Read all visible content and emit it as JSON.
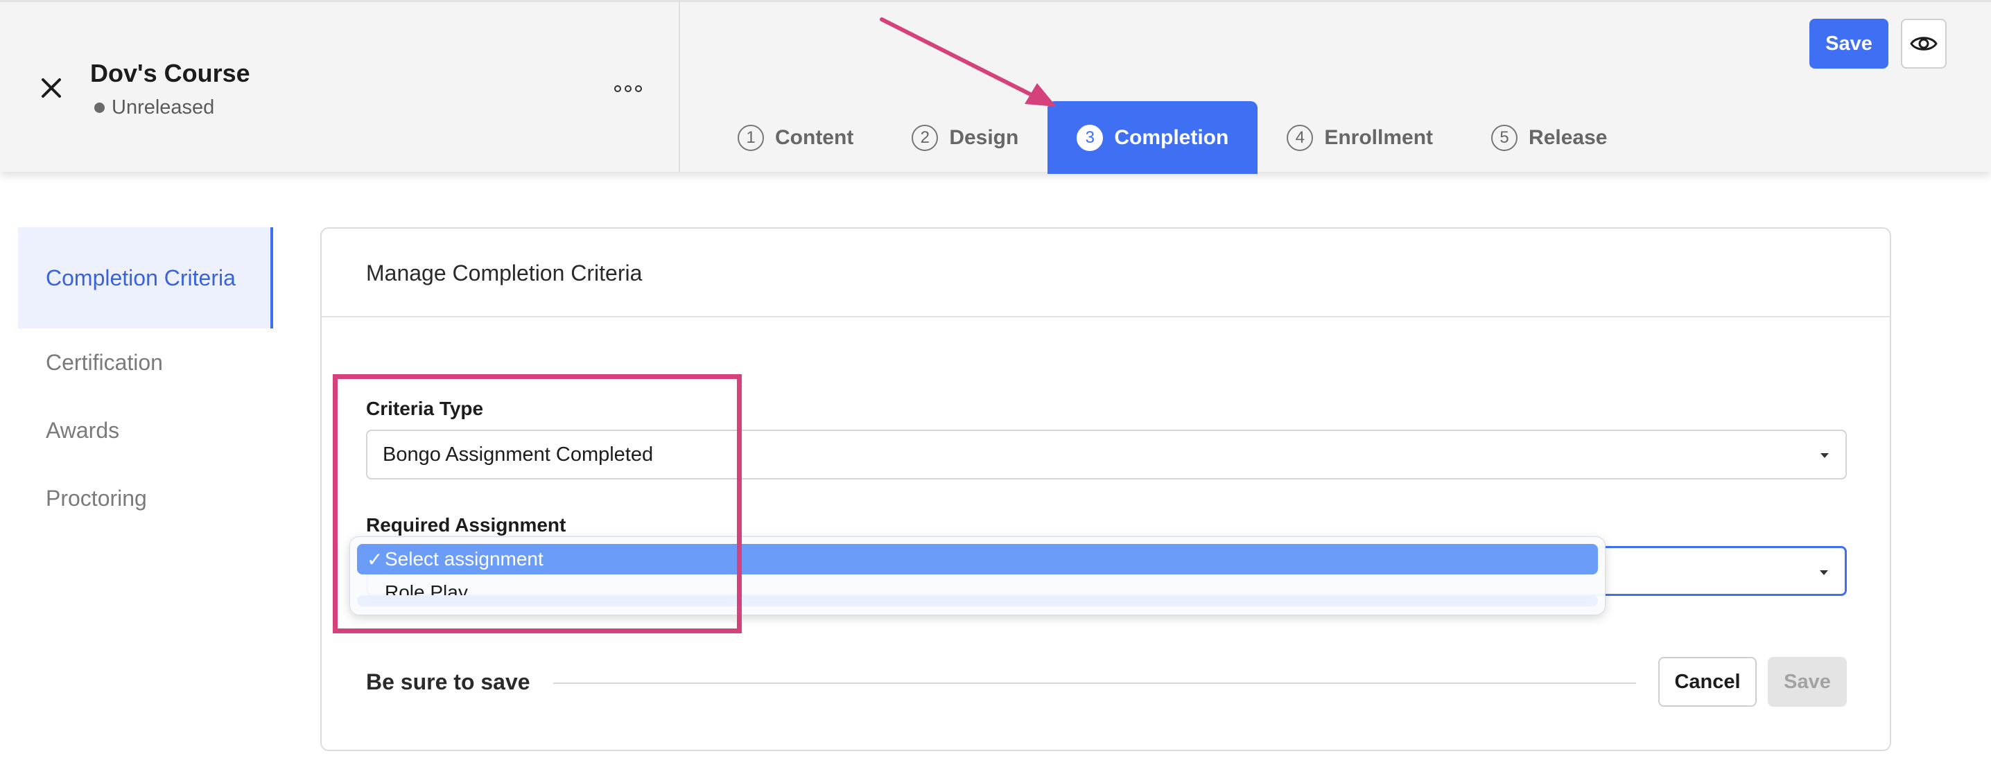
{
  "header": {
    "course_title": "Dov's Course",
    "course_status": "Unreleased",
    "save_label": "Save",
    "tabs": [
      {
        "num": "1",
        "label": "Content"
      },
      {
        "num": "2",
        "label": "Design"
      },
      {
        "num": "3",
        "label": "Completion"
      },
      {
        "num": "4",
        "label": "Enrollment"
      },
      {
        "num": "5",
        "label": "Release"
      }
    ],
    "active_tab": "Completion"
  },
  "sidenav": {
    "items": [
      {
        "label": "Completion Criteria"
      },
      {
        "label": "Certification"
      },
      {
        "label": "Awards"
      },
      {
        "label": "Proctoring"
      }
    ]
  },
  "card": {
    "title": "Manage Completion Criteria",
    "criteria_type_label": "Criteria Type",
    "criteria_type_value": "Bongo Assignment Completed",
    "required_assignment_label": "Required Assignment",
    "save_section_title": "Be sure to save",
    "cancel_label": "Cancel",
    "save_label": "Save"
  },
  "dropdown": {
    "options": [
      {
        "label": "Select assignment",
        "selected": true
      },
      {
        "label": "Role Play",
        "selected": false
      }
    ],
    "check_glyph": "✓"
  },
  "colors": {
    "accent": "#3f6ff3",
    "annotation": "#d4417b",
    "selected_option": "#6b9cf7"
  }
}
